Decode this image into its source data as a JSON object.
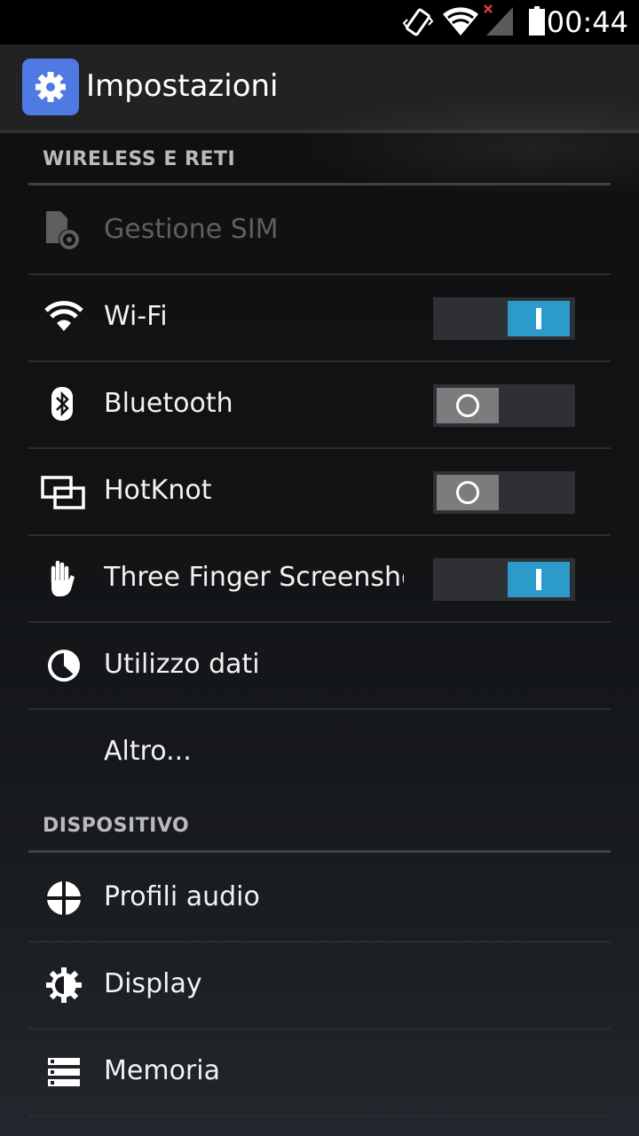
{
  "status_bar": {
    "time": "00:44",
    "icons": [
      "vibrate-icon",
      "wifi-icon",
      "signal-no-service-icon",
      "battery-icon"
    ]
  },
  "action_bar": {
    "title": "Impostazioni",
    "icon": "settings-gear-icon",
    "accent_color": "#4f7ae3"
  },
  "sections": {
    "wireless": {
      "header": "WIRELESS E RETI",
      "items": {
        "sim": {
          "label": "Gestione SIM",
          "icon": "sim-management-icon",
          "enabled": false
        },
        "wifi": {
          "label": "Wi-Fi",
          "icon": "wifi-icon",
          "toggle": "on"
        },
        "bluetooth": {
          "label": "Bluetooth",
          "icon": "bluetooth-icon",
          "toggle": "off"
        },
        "hotknot": {
          "label": "HotKnot",
          "icon": "hotknot-icon",
          "toggle": "off"
        },
        "three_finger": {
          "label": "Three Finger Screenshot",
          "icon": "hand-icon",
          "toggle": "on"
        },
        "data_usage": {
          "label": "Utilizzo dati",
          "icon": "data-usage-icon"
        },
        "more": {
          "label": "Altro..."
        }
      }
    },
    "device": {
      "header": "DISPOSITIVO",
      "items": {
        "audio_profiles": {
          "label": "Profili audio",
          "icon": "audio-profiles-icon"
        },
        "display": {
          "label": "Display",
          "icon": "display-brightness-icon"
        },
        "storage": {
          "label": "Memoria",
          "icon": "storage-icon"
        }
      }
    }
  },
  "colors": {
    "toggle_on": "#2c9bc9",
    "toggle_off": "#7a7c7e",
    "section_header": "#b8babc"
  }
}
